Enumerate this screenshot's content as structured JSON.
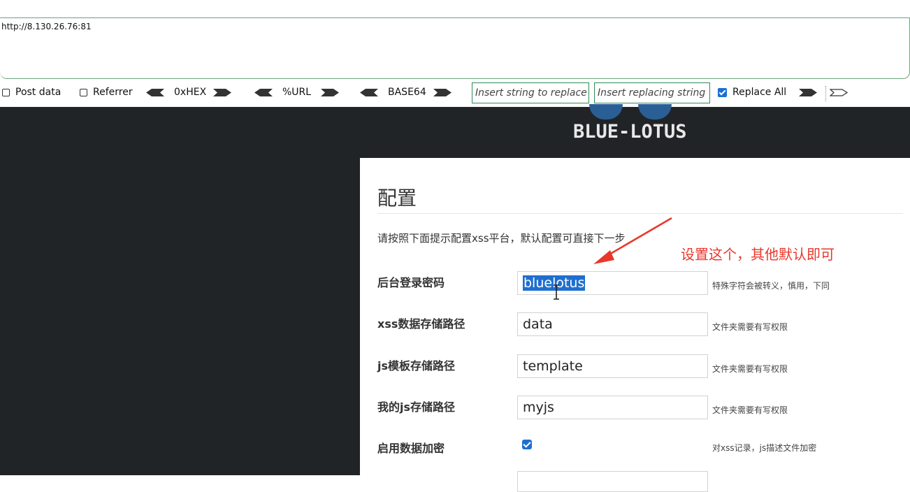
{
  "browser": {
    "url": "http://8.130.26.76:81"
  },
  "hackbar": {
    "post_data_label": "Post data",
    "referrer_label": "Referrer",
    "hex_label": "0xHEX",
    "url_label": "%URL",
    "base64_label": "BASE64",
    "replace_from_placeholder": "Insert string to replace",
    "replace_to_placeholder": "Insert replacing string",
    "replace_all_label": "Replace All",
    "replace_all_checked": true,
    "post_data_checked": false,
    "referrer_checked": false
  },
  "page": {
    "logo_text": "BLUE-LOTUS",
    "logo_color": "#2a5f95",
    "title": "配置",
    "intro": "请按照下面提示配置xss平台，默认配置可直接下一步",
    "annotation": "设置这个，其他默认即可",
    "annotation_color": "#e8372b",
    "fields": [
      {
        "label": "后台登录密码",
        "value": "bluelotus",
        "hint": "特殊字符会被转义，慎用，下同"
      },
      {
        "label": "xss数据存储路径",
        "value": "data",
        "hint": "文件夹需要有写权限"
      },
      {
        "label": "js模板存储路径",
        "value": "template",
        "hint": "文件夹需要有写权限"
      },
      {
        "label": "我的js存储路径",
        "value": "myjs",
        "hint": "文件夹需要有写权限"
      }
    ],
    "encryption": {
      "label": "启用数据加密",
      "checked": true,
      "hint": "对xss记录，js描述文件加密"
    }
  }
}
